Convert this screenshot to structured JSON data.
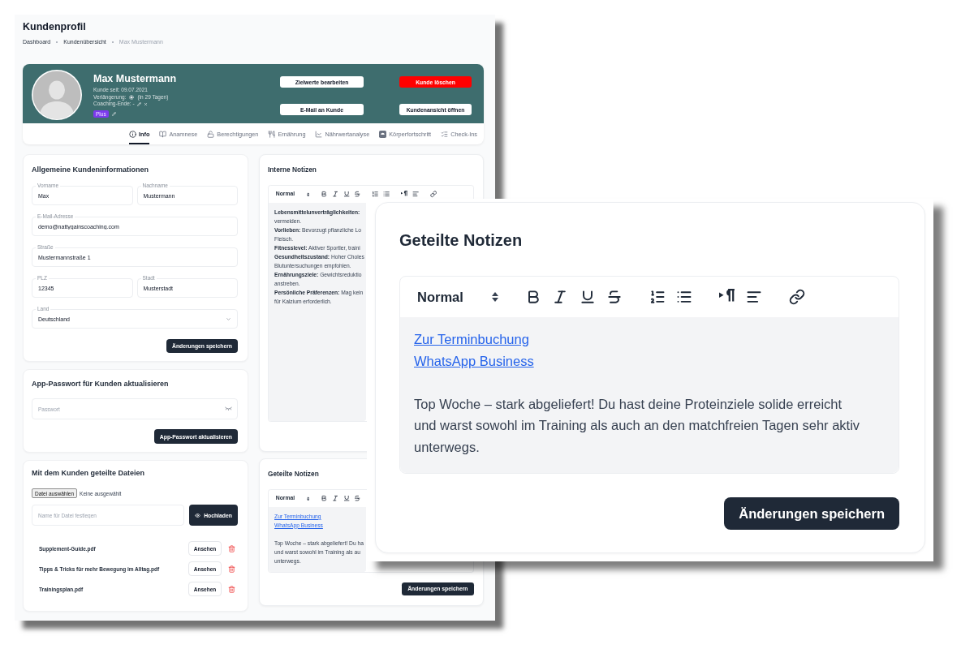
{
  "page": {
    "title": "Kundenprofil",
    "breadcrumbs": [
      {
        "label": "Dashboard",
        "current": false
      },
      {
        "label": "Kundenübersicht",
        "current": false
      },
      {
        "label": "Max Mustermann",
        "current": true
      }
    ]
  },
  "profile": {
    "name": "Max Mustermann",
    "customer_since": "Kunde seit: 09.07.2021",
    "renewal_label": "Verlängerung:",
    "renewal_value": "(in 29 Tagen)",
    "coaching_end": "Coaching-Ende: -",
    "plan_tag": "Plus",
    "buttons": [
      {
        "label": "Zielwerte bearbeiten",
        "kind": "light"
      },
      {
        "label": "Kunde löschen",
        "kind": "danger"
      },
      {
        "label": "E-Mail an Kunde",
        "kind": "light"
      },
      {
        "label": "Kundenansicht öffnen",
        "kind": "light"
      }
    ]
  },
  "tabs": [
    {
      "label": "Info",
      "selected": true
    },
    {
      "label": "Anamnese",
      "selected": false
    },
    {
      "label": "Berechtigungen",
      "selected": false
    },
    {
      "label": "Ernährung",
      "selected": false
    },
    {
      "label": "Nährwertanalyse",
      "selected": false
    },
    {
      "label": "Körperfortschritt",
      "selected": false
    },
    {
      "label": "Check-Ins",
      "selected": false
    }
  ],
  "general_info": {
    "title": "Allgemeine Kundeninformationen",
    "rows": [
      {
        "fields": [
          {
            "label": "Vorname",
            "value": "Max",
            "kind": "text"
          },
          {
            "label": "Nachname",
            "value": "Mustermann",
            "kind": "text"
          }
        ]
      },
      {
        "fields": [
          {
            "label": "E-Mail-Adresse",
            "value": "demo@nattygainscoaching.com",
            "kind": "text"
          }
        ]
      },
      {
        "fields": [
          {
            "label": "Straße",
            "value": "Mustermannstraße 1",
            "kind": "text"
          }
        ]
      },
      {
        "fields": [
          {
            "label": "PLZ",
            "value": "12345",
            "kind": "text"
          },
          {
            "label": "Stadt",
            "value": "Musterstadt",
            "kind": "text"
          }
        ]
      },
      {
        "fields": [
          {
            "label": "Land",
            "value": "Deutschland",
            "kind": "select"
          }
        ]
      }
    ],
    "button": "Änderungen speichern"
  },
  "app_password": {
    "title": "App-Passwort für Kunden aktualisieren",
    "placeholder": "Passwort",
    "button": "App-Passwort aktualisieren"
  },
  "shared_files": {
    "title": "Mit dem Kunden geteilte Dateien",
    "file_picker": {
      "button": "Datei auswählen",
      "status": "Keine ausgewählt"
    },
    "name_field": {
      "placeholder": "Name für Datei festlegen"
    },
    "upload_button": "Hochladen",
    "files": [
      {
        "name": "Supplement-Guide.pdf",
        "button": "Ansehen"
      },
      {
        "name": "Tipps & Tricks für mehr Bewegung im Alltag.pdf",
        "button": "Ansehen"
      },
      {
        "name": "Trainingsplan.pdf",
        "button": "Ansehen"
      }
    ]
  },
  "internal_notes": {
    "title": "Interne Notizen",
    "format": "Normal",
    "lines": [
      {
        "label": "Lebensmittelunverträglichkeiten:"
      },
      {
        "text": "vermeiden."
      },
      {
        "label": "Vorlieben:",
        "text": "Bevorzugt pflanzliche Lo"
      },
      {
        "text": "Fleisch."
      },
      {
        "label": "Fitnesslevel:",
        "text": "Aktiver Sportler, traini"
      },
      {
        "label": "Gesundheitszustand:",
        "text": "Hoher Choles"
      },
      {
        "text": "Blutuntersuchungen empfohlen."
      },
      {
        "label": "Ernährungsziele:",
        "text": "Gewichtsreduktio"
      },
      {
        "text": "anstreben."
      },
      {
        "label": "Persönliche Präferenzen:",
        "text": "Mag kein"
      },
      {
        "text": "für Kalzium erforderlich."
      }
    ]
  },
  "shared_notes": {
    "title": "Geteilte Notizen",
    "format": "Normal",
    "links": [
      "Zur Terminbuchung",
      "WhatsApp Business"
    ],
    "lines": [
      "Top Woche – stark abgeliefert! Du ha",
      "und warst sowohl im Training als au",
      "unterwegs."
    ],
    "button": "Änderungen speichern"
  },
  "zoomed_shared_notes": {
    "title": "Geteilte Notizen",
    "format": "Normal",
    "links": [
      "Zur Terminbuchung",
      "WhatsApp Business"
    ],
    "text": "Top Woche – stark abgeliefert! Du hast deine Proteinziele solide erreicht und warst sowohl im Training als auch an den matchfreien Tagen sehr aktiv unterwegs.",
    "button": "Änderungen speichern"
  }
}
